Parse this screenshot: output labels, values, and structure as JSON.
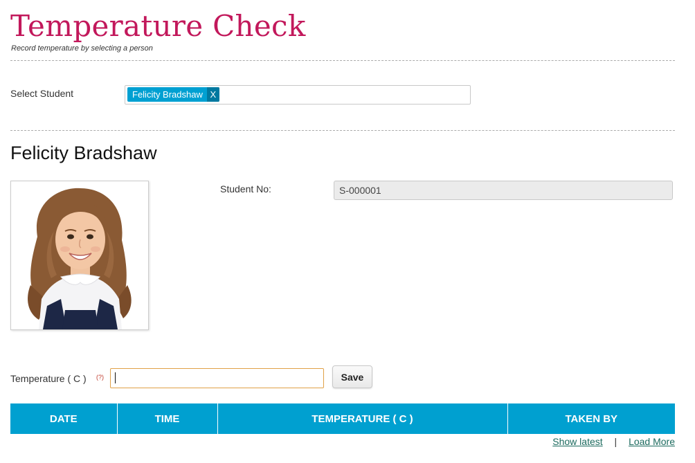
{
  "header": {
    "title": "Temperature Check",
    "subtitle": "Record temperature by selecting a person"
  },
  "student_select": {
    "label": "Select Student",
    "selected_tag": "Felicity Bradshaw",
    "remove_label": "X"
  },
  "student": {
    "name": "Felicity Bradshaw",
    "student_no_label": "Student No:",
    "student_no": "S-000001"
  },
  "temperature": {
    "label": "Temperature ( C )",
    "required_hint": "(?)",
    "value": "",
    "save_label": "Save"
  },
  "table": {
    "columns": [
      "DATE",
      "TIME",
      "TEMPERATURE ( C )",
      "TAKEN BY"
    ],
    "header_color": "#00a0d0"
  },
  "footer": {
    "show_latest": "Show latest",
    "separator": "|",
    "load_more": "Load More"
  },
  "colors": {
    "title": "#c2185b",
    "tag": "#00a0d2",
    "tag_remove": "#0079a0",
    "link": "#1b6a5e",
    "input_focus_border": "#e0a046"
  }
}
